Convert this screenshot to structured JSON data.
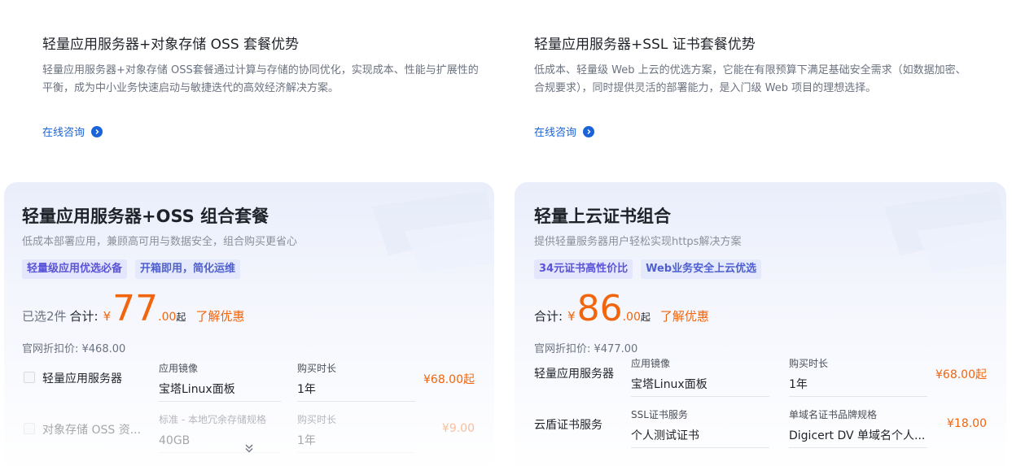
{
  "advantages": [
    {
      "title": "轻量应用服务器+对象存储 OSS 套餐优势",
      "desc": "轻量应用服务器+对象存储 OSS套餐通过计算与存储的协同优化，实现成本、性能与扩展性的平衡，成为中小业务快速启动与敏捷迭代的高效经济解决方案。",
      "link": "在线咨询"
    },
    {
      "title": "轻量应用服务器+SSL 证书套餐优势",
      "desc": "低成本、轻量级 Web 上云的优选方案，它能在有限预算下满足基础安全需求（如数据加密、合规要求），同时提供灵活的部署能力，是入门级 Web 项目的理想选择。",
      "link": "在线咨询"
    }
  ],
  "cards": [
    {
      "title": "轻量应用服务器+OSS 组合套餐",
      "subtitle": "低成本部署应用，兼顾高可用与数据安全，组合购买更省心",
      "tags": [
        "轻量级应用优选必备",
        "开箱即用，简化运维"
      ],
      "selected": "已选2件",
      "total_label": "合计:",
      "currency": "¥",
      "price_int": "77",
      "price_dec": ".00",
      "price_suffix": "起",
      "promo_link": "了解优惠",
      "original_price": "官网折扣价: ¥468.00",
      "items": [
        {
          "name": "轻量应用服务器",
          "f1_label": "应用镜像",
          "f1_value": "宝塔Linux面板",
          "f2_label": "购买时长",
          "f2_value": "1年",
          "price": "¥68.00起"
        },
        {
          "name": "对象存储 OSS 资...",
          "f1_label": "标准 - 本地冗余存储规格",
          "f1_value": "40GB",
          "f2_label": "购买时长",
          "f2_value": "1年",
          "price": "¥9.00"
        }
      ]
    },
    {
      "title": "轻量上云证书组合",
      "subtitle": "提供轻量服务器用户轻松实现https解决方案",
      "tags": [
        "34元证书高性价比",
        "Web业务安全上云优选"
      ],
      "total_label": "合计:",
      "currency": "¥",
      "price_int": "86",
      "price_dec": ".00",
      "price_suffix": "起",
      "promo_link": "了解优惠",
      "original_price": "官网折扣价: ¥477.00",
      "items": [
        {
          "name": "轻量应用服务器",
          "f1_label": "应用镜像",
          "f1_value": "宝塔Linux面板",
          "f2_label": "购买时长",
          "f2_value": "1年",
          "price": "¥68.00起"
        },
        {
          "name": "云盾证书服务",
          "f1_label": "SSL证书服务",
          "f1_value": "个人测试证书",
          "f2_label": "单域名证书品牌规格",
          "f2_value": "Digicert DV 单域名个人...",
          "price": "¥18.00"
        }
      ]
    }
  ],
  "colors": {
    "accent_orange": "#f0650d",
    "link_blue": "#1a63d8"
  },
  "icons": {
    "consult_arrow": "chevron-right-circle-icon",
    "expand": "double-chevron-down-icon"
  }
}
